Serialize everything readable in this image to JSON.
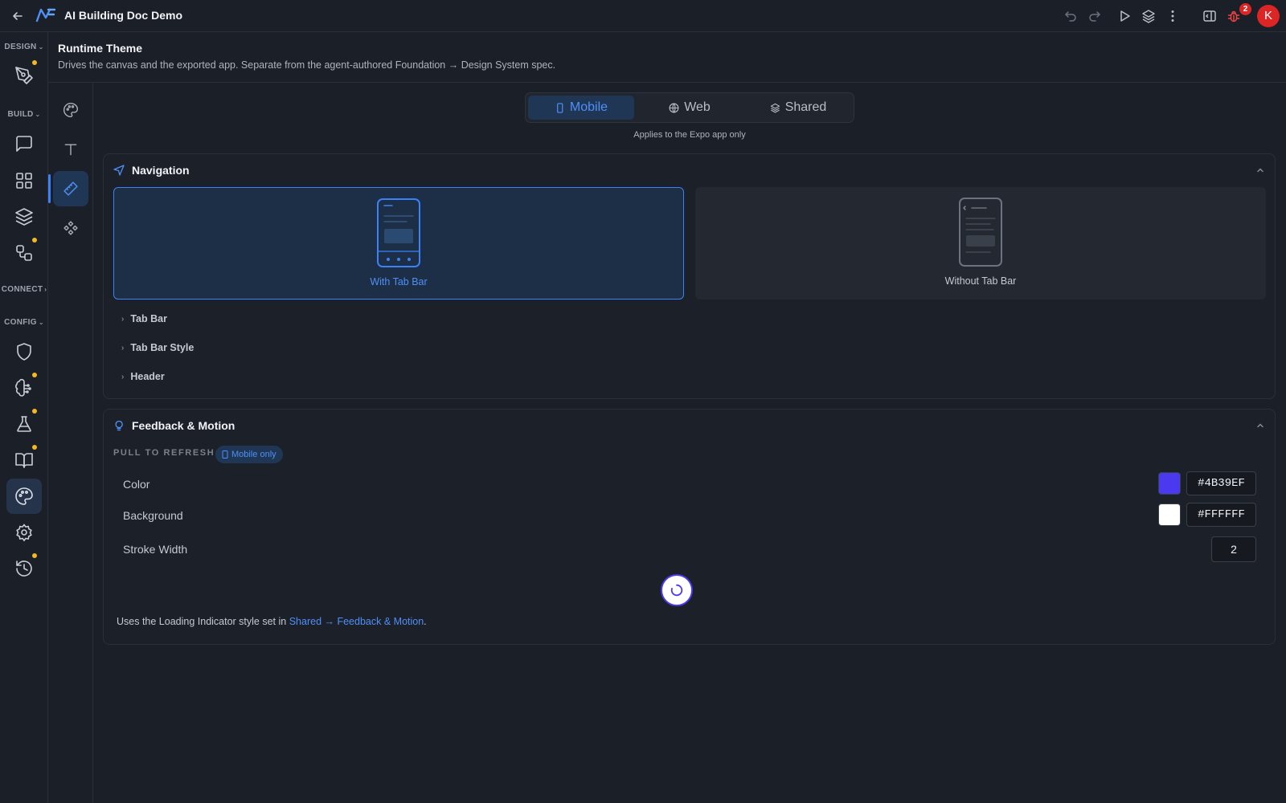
{
  "app": {
    "title": "AI Building Doc Demo",
    "bug_count": "2",
    "avatar_initial": "K",
    "accent": "#3b82f6",
    "indicator_dot": "#f5b722"
  },
  "rail": {
    "headings": {
      "design": "DESIGN",
      "build": "BUILD",
      "connect": "CONNECT",
      "config": "CONFIG"
    },
    "items": [
      {
        "name": "pen-tool-icon",
        "dot": true
      },
      {
        "name": "chat-icon",
        "dot": false
      },
      {
        "name": "grid-icon",
        "dot": false
      },
      {
        "name": "layers-icon",
        "dot": false
      },
      {
        "name": "workflow-icon",
        "dot": true
      },
      {
        "name": "shield-icon",
        "dot": false
      },
      {
        "name": "brain-icon",
        "dot": true
      },
      {
        "name": "flask-icon",
        "dot": true
      },
      {
        "name": "book-icon",
        "dot": true
      },
      {
        "name": "palette-icon",
        "active": true
      },
      {
        "name": "gear-icon",
        "dot": false
      },
      {
        "name": "history-icon",
        "dot": true
      }
    ]
  },
  "subrail": {
    "items": [
      "palette-icon",
      "typography-icon",
      "ruler-icon",
      "components-icon"
    ],
    "active": "ruler-icon"
  },
  "page": {
    "title": "Runtime Theme",
    "description": "Drives the canvas and the exported app. Separate from the agent-authored Foundation → Design System spec."
  },
  "platform_tabs": {
    "items": [
      {
        "label": "Mobile",
        "icon": "phone-icon",
        "active": true
      },
      {
        "label": "Web",
        "icon": "globe-icon",
        "active": false
      },
      {
        "label": "Shared",
        "icon": "layers-icon",
        "active": false
      }
    ],
    "hint": "Applies to the Expo app only"
  },
  "navigation": {
    "title": "Navigation",
    "icon": "navigation-arrow-icon",
    "options": [
      {
        "label": "With Tab Bar",
        "selected": true
      },
      {
        "label": "Without Tab Bar",
        "selected": false
      }
    ],
    "collapsibles": [
      "Tab Bar",
      "Tab Bar Style",
      "Header"
    ]
  },
  "feedback": {
    "title": "Feedback & Motion",
    "icon": "lightbulb-icon",
    "section_label": "PULL TO REFRESH",
    "badge": "Mobile only",
    "rows": {
      "color": {
        "label": "Color",
        "value": "#4B39EF"
      },
      "background": {
        "label": "Background",
        "value": "#FFFFFF"
      },
      "stroke_width": {
        "label": "Stroke Width",
        "value": "2"
      }
    },
    "note_prefix": "Uses the Loading Indicator style set in ",
    "note_link": "Shared → Feedback & Motion",
    "note_suffix": "."
  }
}
